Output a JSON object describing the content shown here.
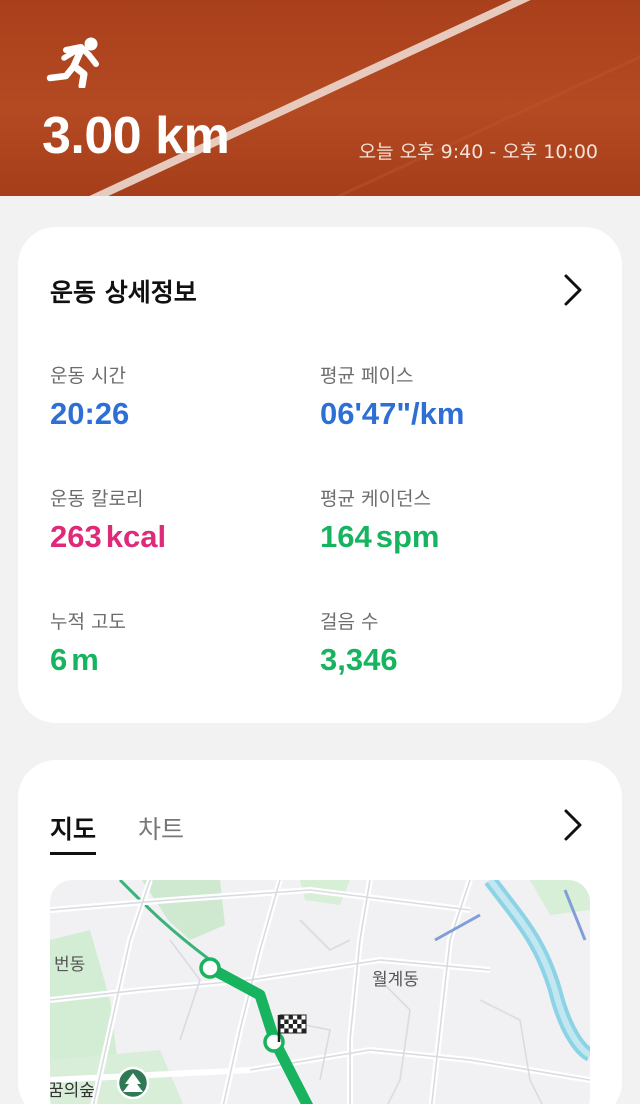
{
  "header": {
    "distance": "3.00 km",
    "time_range": "오늘 오후 9:40 - 오후 10:00",
    "activity_icon": "running-person-icon",
    "colors": {
      "track": "#a9401c",
      "lane_line": "#e9d3c8"
    }
  },
  "details": {
    "title": "운동 상세정보",
    "metrics": {
      "duration": {
        "label": "운동 시간",
        "value": "20:26",
        "color": "#2e6fd6"
      },
      "pace": {
        "label": "평균 페이스",
        "value": "06'47\"/km",
        "color": "#2e6fd6"
      },
      "calories": {
        "label": "운동 칼로리",
        "value": "263",
        "unit": "kcal",
        "color": "#df2a7a"
      },
      "cadence": {
        "label": "평균 케이던스",
        "value": "164",
        "unit": "spm",
        "color": "#16b45f"
      },
      "elevation": {
        "label": "누적 고도",
        "value": "6",
        "unit": "m",
        "color": "#16b45f"
      },
      "steps": {
        "label": "걸음 수",
        "value": "3,346",
        "color": "#16b45f"
      }
    }
  },
  "map_section": {
    "tabs": [
      {
        "label": "지도",
        "active": true
      },
      {
        "label": "차트",
        "active": false
      }
    ],
    "map_labels": {
      "district_left": "번동",
      "district_right": "월계동",
      "forest": "꿈의숲"
    },
    "route_color": "#17b35e"
  }
}
